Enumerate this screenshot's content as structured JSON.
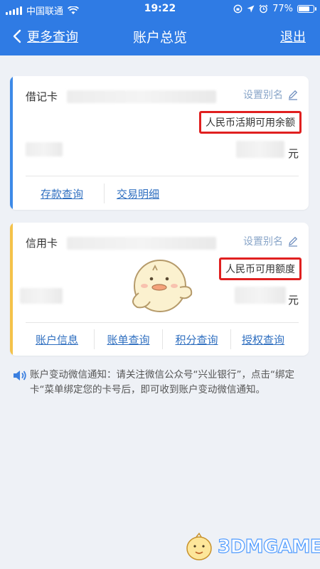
{
  "status_bar": {
    "carrier": "中国联通",
    "time": "19:22",
    "battery": "77%",
    "battery_level": 0.77
  },
  "nav": {
    "back_label": "更多查询",
    "title": "账户总览",
    "logout_label": "退出"
  },
  "debit_card": {
    "type_label": "借记卡",
    "alias_label": "设置别名",
    "balance_label": "人民币活期可用余额",
    "currency_unit": "元",
    "actions": [
      "存款查询",
      "交易明细"
    ]
  },
  "credit_card": {
    "type_label": "信用卡",
    "alias_label": "设置别名",
    "balance_label": "人民币可用额度",
    "currency_unit": "元",
    "actions": [
      "账户信息",
      "账单查询",
      "积分查询",
      "授权查询"
    ]
  },
  "notice": {
    "text": "账户变动微信通知：请关注微信公众号“兴业银行”，点击“绑定卡“菜单绑定您的卡号后，即可收到账户变动微信通知。"
  },
  "watermark": {
    "text": "3DMGAME"
  },
  "colors": {
    "nav_blue": "#2f7be4",
    "debit_stripe": "#3d8ae8",
    "credit_stripe": "#f4c24a",
    "highlight_red": "#e02020",
    "link_blue": "#2f6fc0"
  }
}
